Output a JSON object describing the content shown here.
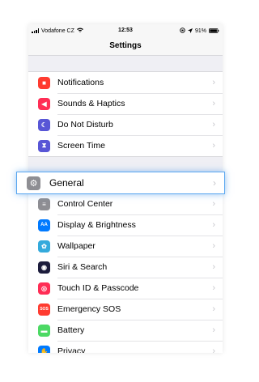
{
  "status_bar": {
    "carrier": "Vodafone CZ",
    "time": "12:53",
    "battery": "91%"
  },
  "nav": {
    "title": "Settings"
  },
  "group1": [
    {
      "label": "Notifications",
      "icon": "notifications-icon",
      "color": "#ff3b30",
      "glyph": "■"
    },
    {
      "label": "Sounds & Haptics",
      "icon": "speaker-icon",
      "color": "#ff2d55",
      "glyph": "◀"
    },
    {
      "label": "Do Not Disturb",
      "icon": "moon-icon",
      "color": "#5856d6",
      "glyph": "☾"
    },
    {
      "label": "Screen Time",
      "icon": "hourglass-icon",
      "color": "#5856d6",
      "glyph": "⧗"
    }
  ],
  "highlighted": {
    "label": "General",
    "icon": "gear-icon",
    "color": "#8e8e93",
    "glyph": "⚙"
  },
  "group2": [
    {
      "label": "Control Center",
      "icon": "control-center-icon",
      "color": "#8e8e93",
      "glyph": "≡"
    },
    {
      "label": "Display & Brightness",
      "icon": "display-icon",
      "color": "#007aff",
      "glyph": "AA"
    },
    {
      "label": "Wallpaper",
      "icon": "wallpaper-icon",
      "color": "#34aadc",
      "glyph": "✿"
    },
    {
      "label": "Siri & Search",
      "icon": "siri-icon",
      "color": "#1c1c3c",
      "glyph": "◉"
    },
    {
      "label": "Touch ID & Passcode",
      "icon": "fingerprint-icon",
      "color": "#ff2d55",
      "glyph": "◎"
    },
    {
      "label": "Emergency SOS",
      "icon": "sos-icon",
      "color": "#ff3b30",
      "glyph": "SOS"
    },
    {
      "label": "Battery",
      "icon": "battery-icon",
      "color": "#4cd964",
      "glyph": "▬"
    },
    {
      "label": "Privacy",
      "icon": "privacy-icon",
      "color": "#007aff",
      "glyph": "✋"
    }
  ]
}
